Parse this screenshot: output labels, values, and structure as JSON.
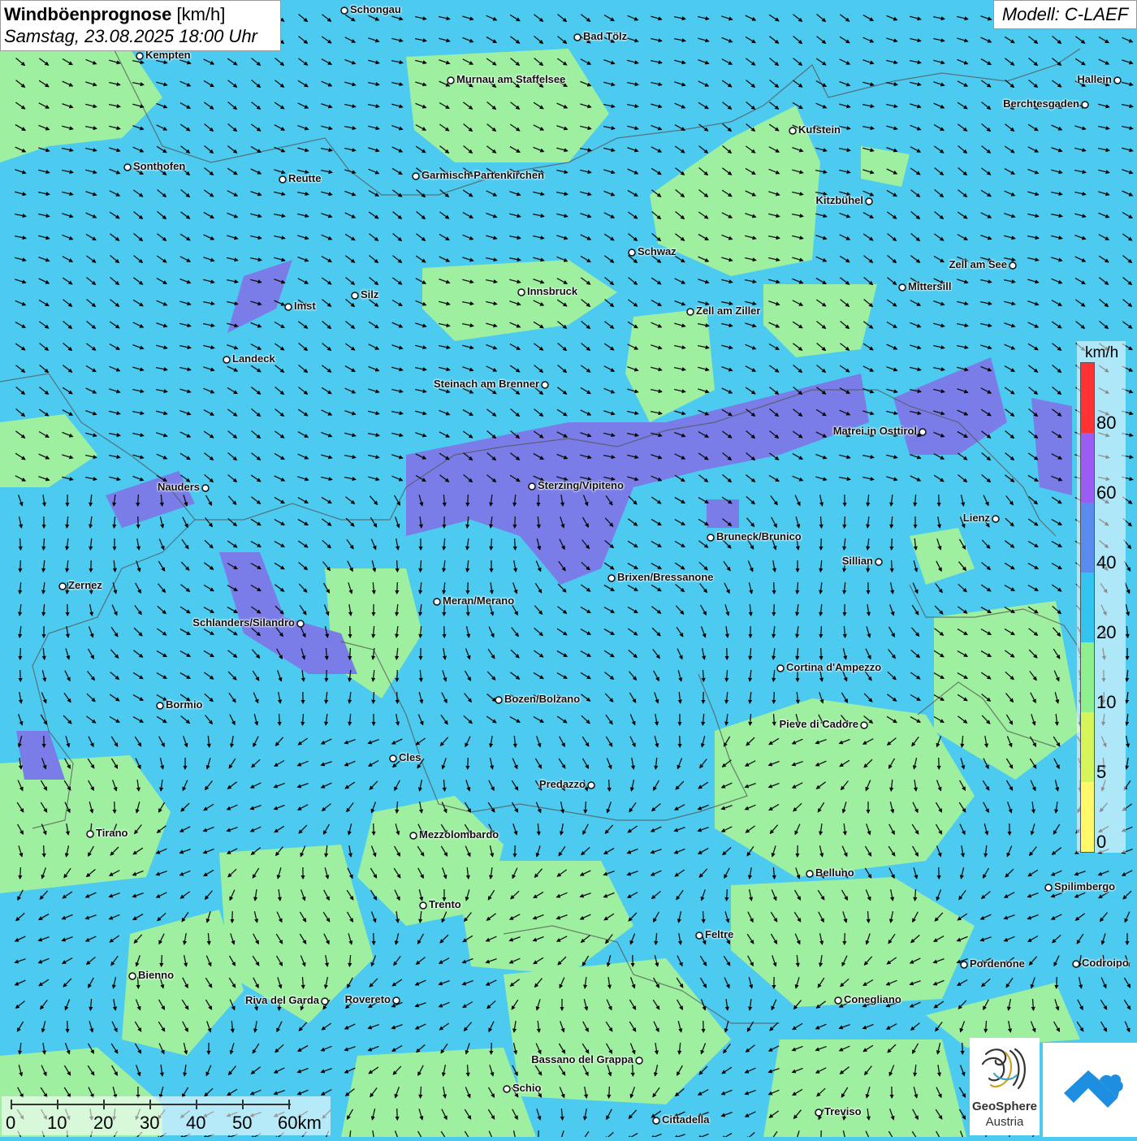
{
  "header": {
    "title_bold": "Windböenprognose",
    "title_unit": " [km/h]",
    "datetime": "Samstag, 23.08.2025 18:00 Uhr",
    "model": "Modell: C-LAEF"
  },
  "legend": {
    "unit": "km/h",
    "labels": [
      "80",
      "60",
      "40",
      "20",
      "10",
      "5",
      "0"
    ],
    "colors": [
      "#ff3333",
      "#9a5cf2",
      "#5a8cf0",
      "#33c4f0",
      "#8ef08e",
      "#d6f55a",
      "#fff86a"
    ]
  },
  "scalebar": {
    "labels": [
      "0",
      "10",
      "20",
      "30",
      "40",
      "50",
      "60km"
    ]
  },
  "logo": {
    "line1": "GeoSphere",
    "line2": "Austria",
    "brand_color": "#1e8ee0"
  },
  "map_colors": {
    "gust_20_40": "#4ccaf0",
    "gust_10_20": "#9ef0a0",
    "gust_40_60": "#7a7ce8"
  },
  "cities": [
    {
      "name": "Schongau"
    },
    {
      "name": "Bad Tölz"
    },
    {
      "name": "Kempten"
    },
    {
      "name": "Murnau am Staffelsee"
    },
    {
      "name": "Hallein"
    },
    {
      "name": "Berchtesgaden"
    },
    {
      "name": "Kufstein"
    },
    {
      "name": "Sonthofen"
    },
    {
      "name": "Reutte"
    },
    {
      "name": "Garmisch-Partenkirchen"
    },
    {
      "name": "Kitzbühel"
    },
    {
      "name": "Schwaz"
    },
    {
      "name": "Zell am See"
    },
    {
      "name": "Innsbruck"
    },
    {
      "name": "Mittersill"
    },
    {
      "name": "Silz"
    },
    {
      "name": "Imst"
    },
    {
      "name": "Zell am Ziller"
    },
    {
      "name": "Landeck"
    },
    {
      "name": "Steinach am Brenner"
    },
    {
      "name": "Matrei in Osttirol"
    },
    {
      "name": "Nauders"
    },
    {
      "name": "Sterzing/Vipiteno"
    },
    {
      "name": "Lienz"
    },
    {
      "name": "Bruneck/Brunico"
    },
    {
      "name": "Sillian"
    },
    {
      "name": "Brixen/Bressanone"
    },
    {
      "name": "Zernez"
    },
    {
      "name": "Meran/Merano"
    },
    {
      "name": "Schlanders/Silandro"
    },
    {
      "name": "Cortina d'Ampezzo"
    },
    {
      "name": "Bozen/Bolzano"
    },
    {
      "name": "Bormio"
    },
    {
      "name": "Pieve di Cadore"
    },
    {
      "name": "Cles"
    },
    {
      "name": "Predazzo"
    },
    {
      "name": "Tirano"
    },
    {
      "name": "Mezzolombardo"
    },
    {
      "name": "Belluno"
    },
    {
      "name": "Spilimbergo"
    },
    {
      "name": "Trento"
    },
    {
      "name": "Feltre"
    },
    {
      "name": "Pordenone"
    },
    {
      "name": "Codroipo"
    },
    {
      "name": "Bienno"
    },
    {
      "name": "Riva del Garda"
    },
    {
      "name": "Rovereto"
    },
    {
      "name": "Conegliano"
    },
    {
      "name": "Bassano del Grappa"
    },
    {
      "name": "Schio"
    },
    {
      "name": "Treviso"
    },
    {
      "name": "Cittadella"
    }
  ]
}
